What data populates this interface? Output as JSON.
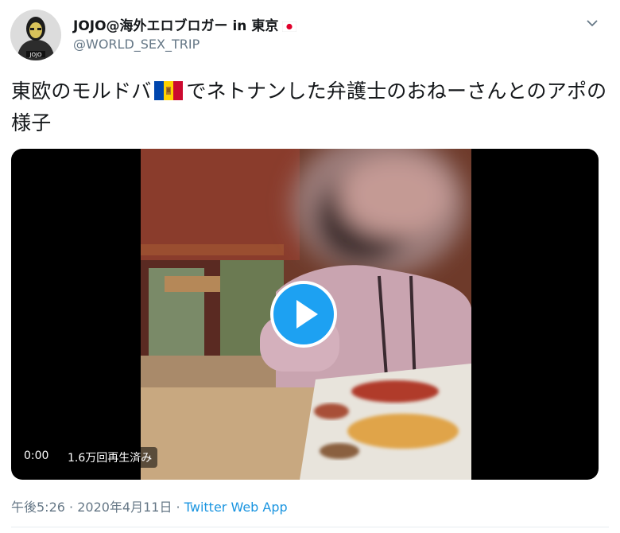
{
  "user": {
    "display_name": "JOJO@海外エロブロガー in 東京",
    "flag_icon": "japan-flag-icon",
    "handle": "@WORLD_SEX_TRIP",
    "avatar_label": "JOJO"
  },
  "tweet": {
    "text_part1": "東欧のモルドバ",
    "flag_icon": "moldova-flag-icon",
    "text_part2": "でネトナンした弁護士のおねーさんとのアポの様子"
  },
  "video": {
    "time": "0:00",
    "views": "1.6万回再生済み",
    "play_icon": "play-icon"
  },
  "meta": {
    "time": "午後5:26",
    "separator1": " · ",
    "date": "2020年4月11日",
    "separator2": " · ",
    "app": "Twitter Web App"
  },
  "colors": {
    "accent": "#1da1f2",
    "link": "#1b95e0",
    "secondary_text": "#657786"
  }
}
